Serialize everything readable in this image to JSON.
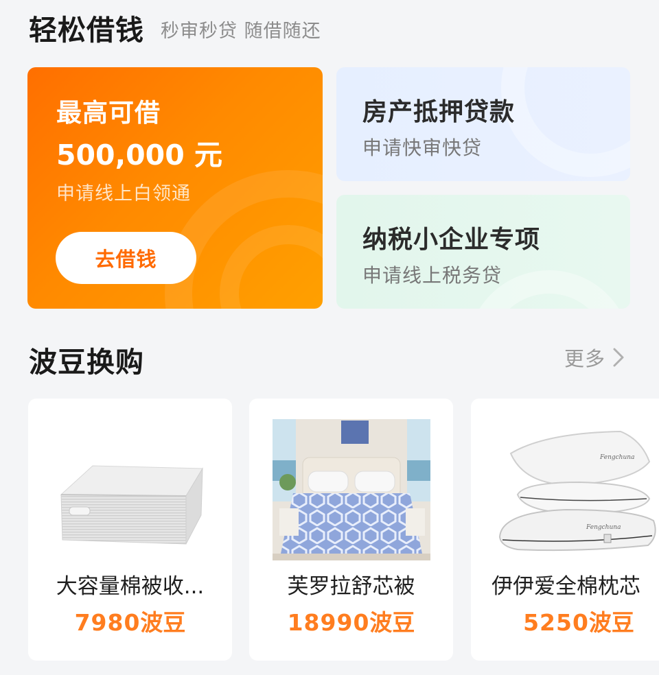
{
  "easy_loan": {
    "title": "轻松借钱",
    "subtitle": "秒审秒贷 随借随还",
    "main_card": {
      "label": "最高可借",
      "amount": "500,000 元",
      "desc": "申请线上白领通",
      "button": "去借钱"
    },
    "cards": [
      {
        "title": "房产抵押贷款",
        "desc": "申请快审快贷"
      },
      {
        "title": "纳税小企业专项",
        "desc": "申请线上税务贷"
      }
    ]
  },
  "bodou": {
    "title": "波豆换购",
    "more_label": "更多",
    "products": [
      {
        "name": "大容量棉被收...",
        "price": "7980",
        "unit": "波豆",
        "image": "storage-bag-image"
      },
      {
        "name": "芙罗拉舒芯被",
        "price": "18990",
        "unit": "波豆",
        "image": "comforter-bedroom-image"
      },
      {
        "name": "伊伊爱全棉枕芯",
        "price": "5250",
        "unit": "波豆",
        "image": "pillows-image"
      }
    ]
  },
  "colors": {
    "orange_card": "#ff7a00",
    "accent_price": "#ff7d1f",
    "blue_card": "#e6efff",
    "green_card": "#e2f6ec"
  }
}
